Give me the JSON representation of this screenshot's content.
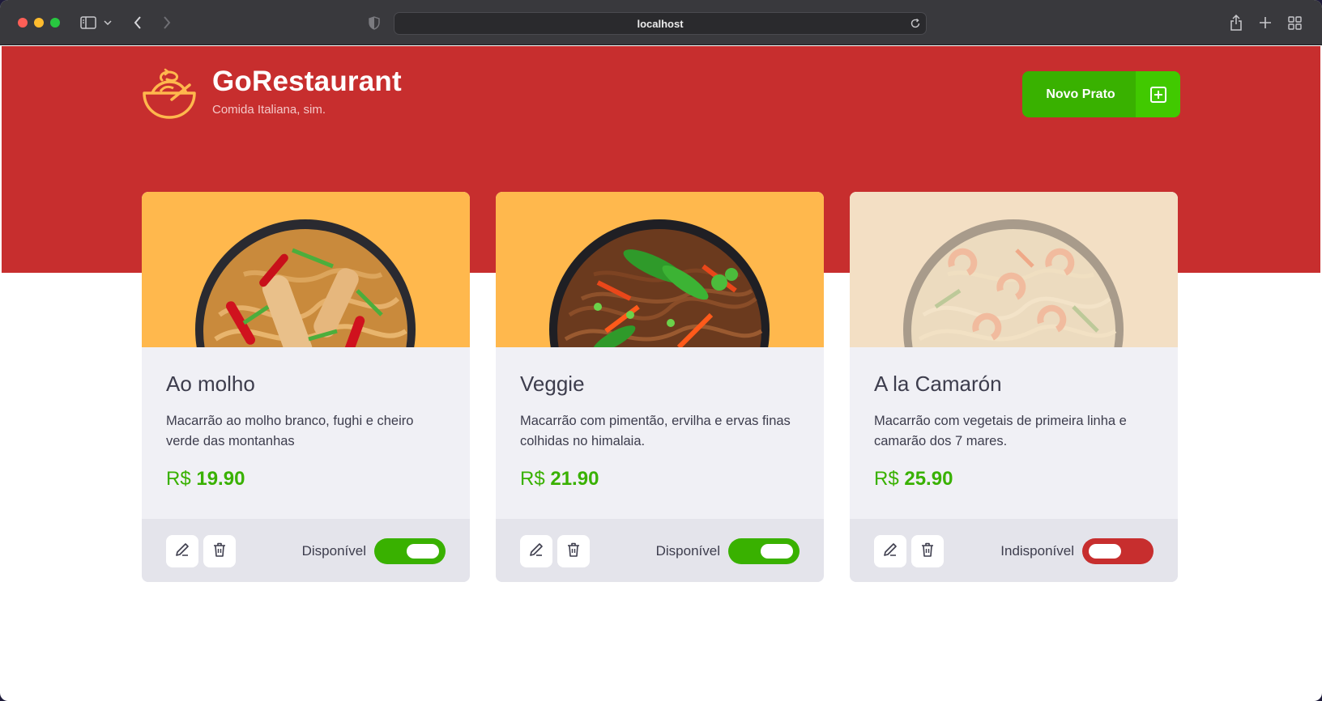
{
  "browser": {
    "url": "localhost",
    "icons": [
      "sidebar-icon",
      "chevron-down-icon",
      "back-icon",
      "forward-icon",
      "shield-icon",
      "reload-icon",
      "share-icon",
      "new-tab-icon",
      "tab-overview-icon"
    ]
  },
  "header": {
    "brand": "GoRestaurant",
    "tagline": "Comida Italiana, sim.",
    "new_dish_label": "Novo Prato",
    "colors": {
      "hero": "#c72e2e",
      "button": "#39b100",
      "button_icon_bg": "#41c900"
    }
  },
  "foods": [
    {
      "name": "Ao molho",
      "description": "Macarrão ao molho branco, fughi e cheiro verde das montanhas",
      "currency": "R$",
      "price": "19.90",
      "status": "Disponível",
      "available": true
    },
    {
      "name": "Veggie",
      "description": "Macarrão com pimentão, ervilha e ervas finas colhidas no himalaia.",
      "currency": "R$",
      "price": "21.90",
      "status": "Disponível",
      "available": true
    },
    {
      "name": "A la Camarón",
      "description": "Macarrão com vegetais de primeira linha e camarão dos 7 mares.",
      "currency": "R$",
      "price": "25.90",
      "status": "Indisponível",
      "available": false
    }
  ]
}
